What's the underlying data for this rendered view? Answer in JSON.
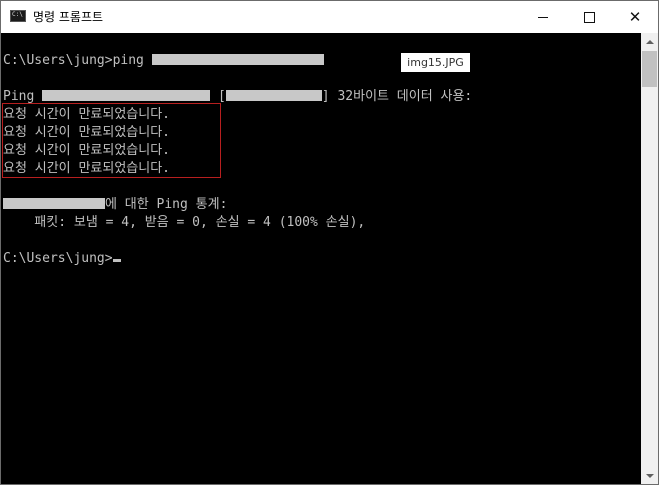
{
  "window": {
    "title": "명령 프롬프트",
    "icon_text": "C:\\",
    "icon": "terminal-icon"
  },
  "controls": {
    "minimize": "minimize-icon",
    "maximize": "maximize-icon",
    "close": "close-icon",
    "close_glyph": "✕"
  },
  "console": {
    "command_prompt": "C:\\Users\\jung>",
    "command": "ping ",
    "ping_prefix": "Ping ",
    "ping_bracket_open": " [",
    "ping_suffix": "] 32바이트 데이터 사용:",
    "timeouts": [
      "요청 시간이 만료되었습니다.",
      "요청 시간이 만료되었습니다.",
      "요청 시간이 만료되었습니다.",
      "요청 시간이 만료되었습니다."
    ],
    "stats_header_suffix": "에 대한 Ping 통계:",
    "stats_line": "    패킷: 보냄 = 4, 받음 = 0, 손실 = 4 (100% 손실),",
    "final_prompt": "C:\\Users\\jung>"
  },
  "overlay_label": "img15.JPG",
  "colors": {
    "console_bg": "#000000",
    "console_text": "#c0c0c0",
    "highlight_border": "#b81f1f",
    "redaction": "#c8c8c8"
  }
}
